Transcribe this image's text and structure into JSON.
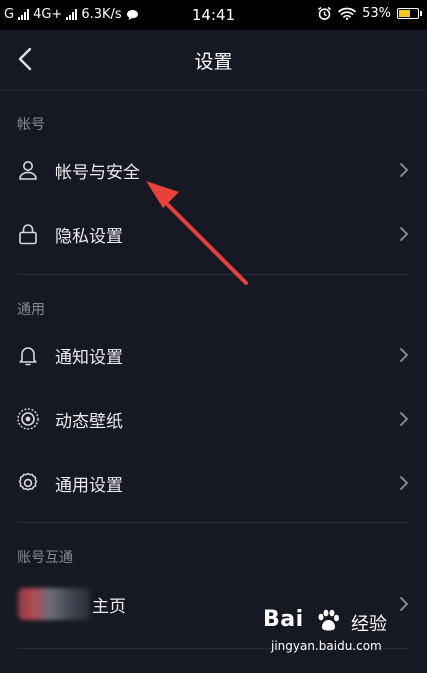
{
  "status_bar": {
    "carrier1": "G",
    "carrier2": "4G+",
    "speed": "6.3K/s",
    "time": "14:41",
    "battery": "53%",
    "battery_level": 0.53
  },
  "header": {
    "title": "设置"
  },
  "sections": [
    {
      "title": "帐号",
      "items": [
        {
          "label": "帐号与安全",
          "icon": "person-icon"
        },
        {
          "label": "隐私设置",
          "icon": "lock-icon"
        }
      ]
    },
    {
      "title": "通用",
      "items": [
        {
          "label": "通知设置",
          "icon": "bell-icon"
        },
        {
          "label": "动态壁纸",
          "icon": "target-icon"
        },
        {
          "label": "通用设置",
          "icon": "gear-icon"
        }
      ]
    },
    {
      "title": "账号互通",
      "items": [
        {
          "label": "主页",
          "icon": "blurred-avatar"
        }
      ]
    }
  ],
  "watermark": {
    "brand": "Bai",
    "brand2": "经验",
    "url": "jingyan.baidu.com"
  },
  "colors": {
    "background": "#161823",
    "annotation_arrow": "#e8403a",
    "battery_fill": "#f5c518"
  }
}
